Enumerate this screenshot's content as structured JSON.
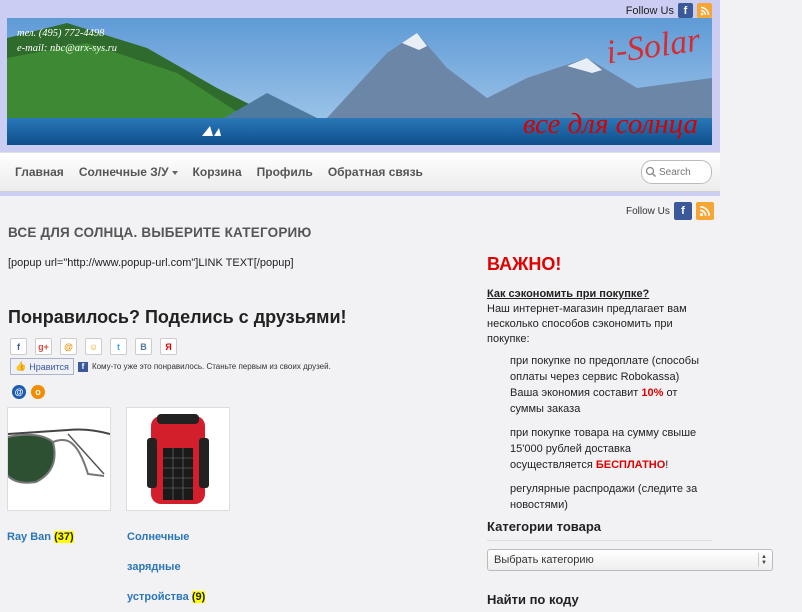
{
  "header": {
    "follow_label": "Follow Us",
    "phone": "тел. (495) 772-4498",
    "email": "e-mail: nbc@arx-sys.ru",
    "brand": "i-Solar",
    "tagline": "все для солнца"
  },
  "nav": {
    "items": [
      "Главная",
      "Солнечные З/У",
      "Корзина",
      "Профиль",
      "Обратная связь"
    ],
    "search_placeholder": "Search"
  },
  "follow2_label": "Follow Us",
  "main": {
    "title": "ВСЕ ДЛЯ СОЛНЦА. ВЫБЕРИТЕ КАТЕГОРИЮ",
    "popup_text": "[popup url=\"http://www.popup-url.com\"]LINK TEXT[/popup]",
    "share_title": "Понравилось? Поделись с друзьями!",
    "share_icons": [
      "f",
      "g+",
      "@",
      "☺",
      "t",
      "B",
      "Я"
    ],
    "like_button": "Нравится",
    "like_text": "Кому-то уже это понравилось. Станьте первым из своих друзей.",
    "products": [
      {
        "name": "Ray Ban",
        "count": "(37)"
      },
      {
        "name_lines": [
          "Солнечные",
          "зарядные",
          "устройства"
        ],
        "count": "(9)"
      }
    ]
  },
  "sidebar": {
    "important": "ВАЖНО!",
    "econ_heading": "Как сэкономить при покупке?",
    "econ_intro": "Наш интернет-магазин предлагает вам несколько способов сэкономить при покупке:",
    "econ_item1_a": "при покупке по предоплате (способы оплаты через сервис Robokassa) Ваша экономия составит ",
    "econ_item1_pct": "10%",
    "econ_item1_b": " от суммы заказа",
    "econ_item2_a": "при покупке товара на сумму свыше 15'000 рублей доставка осуществляется ",
    "econ_item2_free": "БЕСПЛАТНО",
    "econ_item2_b": "!",
    "econ_item3": "регулярные распродажи (следите за новостями)",
    "categories_heading": "Категории товара",
    "category_select": "Выбрать категорию",
    "find_heading": "Найти по коду"
  },
  "colors": {
    "accent_red": "#e00000",
    "link_blue": "#2a76b8",
    "band": "#cbcdf3"
  }
}
